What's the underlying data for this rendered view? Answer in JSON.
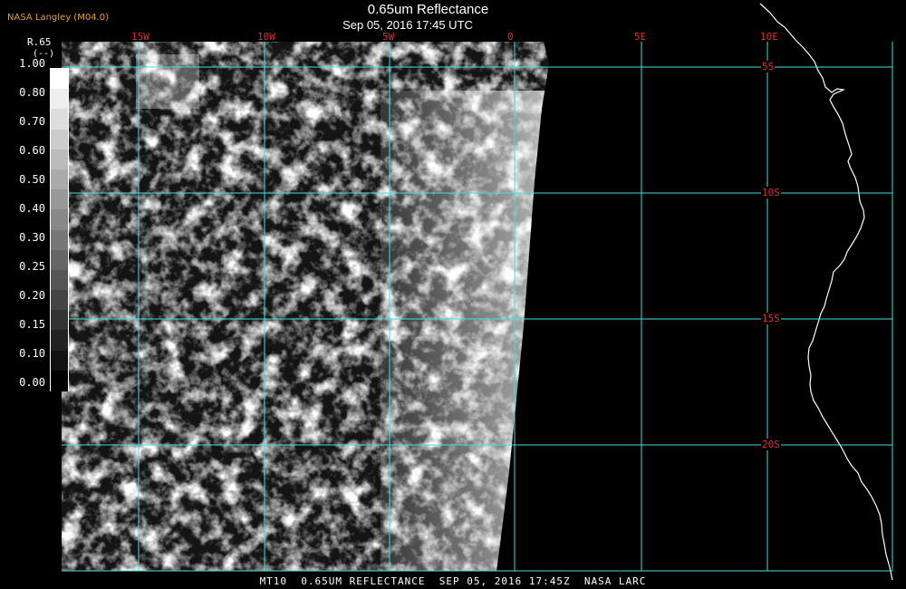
{
  "header": {
    "producer": "NASA Langley (M04.0)",
    "title": "0.65um Reflectance",
    "datetime": "Sep 05, 2016 17:45 UTC"
  },
  "footer": {
    "caption": "MT10  0.65UM REFLECTANCE  SEP 05, 2016 17:45Z  NASA LARC"
  },
  "legend": {
    "name": "R.65",
    "unit": "(--)",
    "ticks": [
      "1.00",
      "0.80",
      "0.70",
      "0.60",
      "0.50",
      "0.40",
      "0.30",
      "0.25",
      "0.20",
      "0.15",
      "0.10",
      "0.00"
    ],
    "gray_levels": [
      "#ffffff",
      "#eeeeee",
      "#dddddd",
      "#cccccc",
      "#bbbbbb",
      "#aaaaaa",
      "#999999",
      "#888888",
      "#777777",
      "#666666",
      "#555555",
      "#444444",
      "#333333",
      "#222222",
      "#111111",
      "#000000"
    ]
  },
  "grid": {
    "color": "#40e0e0",
    "label_color": "#e03030",
    "longitudes": [
      "15W",
      "10W",
      "5W",
      "0",
      "5E",
      "10E"
    ],
    "latitudes": [
      "5S",
      "10S",
      "15S",
      "20S"
    ]
  },
  "map": {
    "coastline_color": "#ffffff",
    "no_data_color": "#000000"
  }
}
